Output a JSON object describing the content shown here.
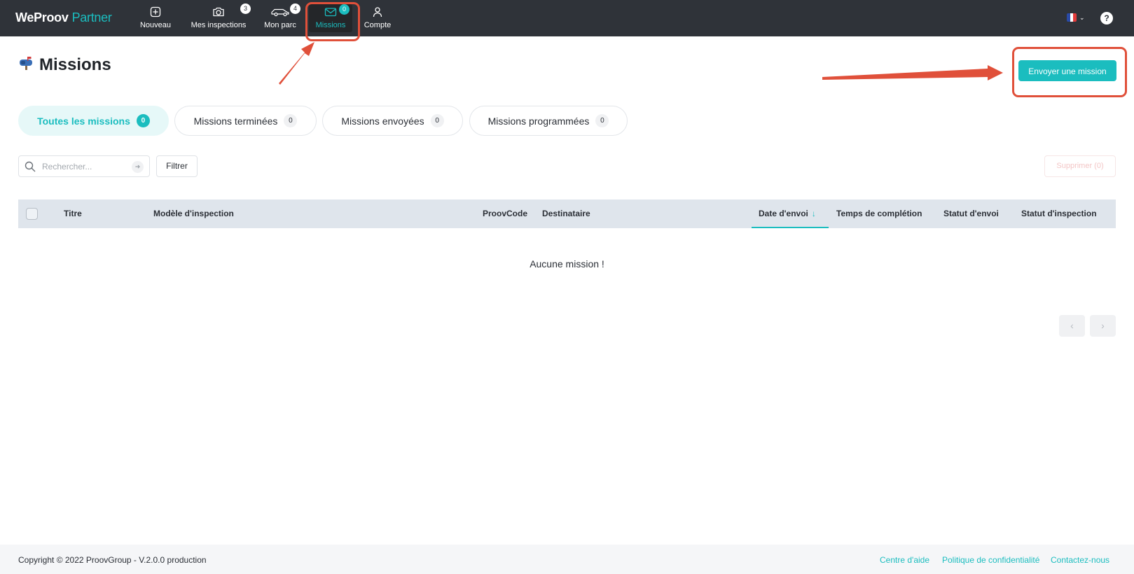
{
  "brand": {
    "word": "WeProov",
    "suffix": "Partner"
  },
  "nav": [
    {
      "label": "Nouveau",
      "icon": "plus-square-icon",
      "badge": ""
    },
    {
      "label": "Mes inspections",
      "icon": "camera-icon",
      "badge": "3"
    },
    {
      "label": "Mon parc",
      "icon": "car-icon",
      "badge": "4"
    },
    {
      "label": "Missions",
      "icon": "mail-icon",
      "badge": "0"
    },
    {
      "label": "Compte",
      "icon": "user-icon",
      "badge": ""
    }
  ],
  "header": {
    "title": "Missions",
    "send_button": "Envoyer une mission",
    "help": "?"
  },
  "tabs": [
    {
      "label": "Toutes les missions",
      "count": "0"
    },
    {
      "label": "Missions terminées",
      "count": "0"
    },
    {
      "label": "Missions envoyées",
      "count": "0"
    },
    {
      "label": "Missions programmées",
      "count": "0"
    }
  ],
  "toolbar": {
    "search_placeholder": "Rechercher...",
    "filter_label": "Filtrer",
    "delete_label": "Supprimer (0)"
  },
  "table": {
    "columns": [
      "Titre",
      "Modèle d'inspection",
      "ProovCode",
      "Destinataire",
      "Date d'envoi",
      "Temps de complétion",
      "Statut d'envoi",
      "Statut d'inspection"
    ],
    "empty_message": "Aucune mission !"
  },
  "footer": {
    "copyright": "Copyright © 2022 ProovGroup - V.2.0.0 production",
    "links": [
      "Centre d'aide",
      "Politique de confidentialité",
      "Contactez-nous"
    ]
  },
  "colors": {
    "accent": "#1bbdbf",
    "nav_bg": "#2f3339",
    "annotation": "#e0503a"
  }
}
